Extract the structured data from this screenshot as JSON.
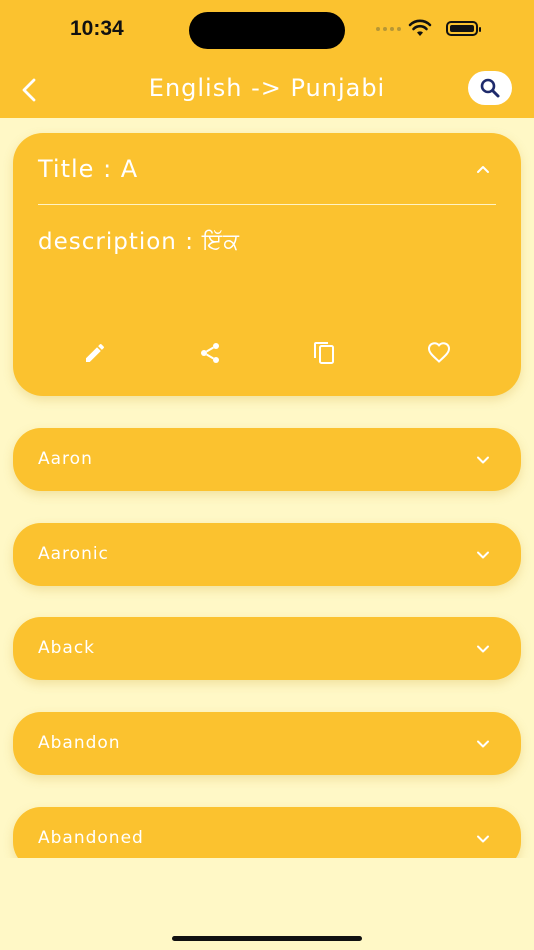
{
  "status_bar": {
    "time": "10:34"
  },
  "header": {
    "title": "English -> Punjabi",
    "back_icon": "chevron-left-icon",
    "search_icon": "search-icon"
  },
  "expanded_entry": {
    "title": "Title : A",
    "description": "description : ਇੱਕ",
    "actions": [
      "edit-icon",
      "share-icon",
      "copy-icon",
      "heart-icon"
    ]
  },
  "words": [
    {
      "label": "Aaron"
    },
    {
      "label": "Aaronic"
    },
    {
      "label": "Aback"
    },
    {
      "label": "Abandon"
    },
    {
      "label": "Abandoned"
    }
  ],
  "colors": {
    "accent": "#FBC22F",
    "background": "#FFF8C6",
    "text_on_accent": "#FFFFFF",
    "search_icon": "#1E2A6B"
  }
}
